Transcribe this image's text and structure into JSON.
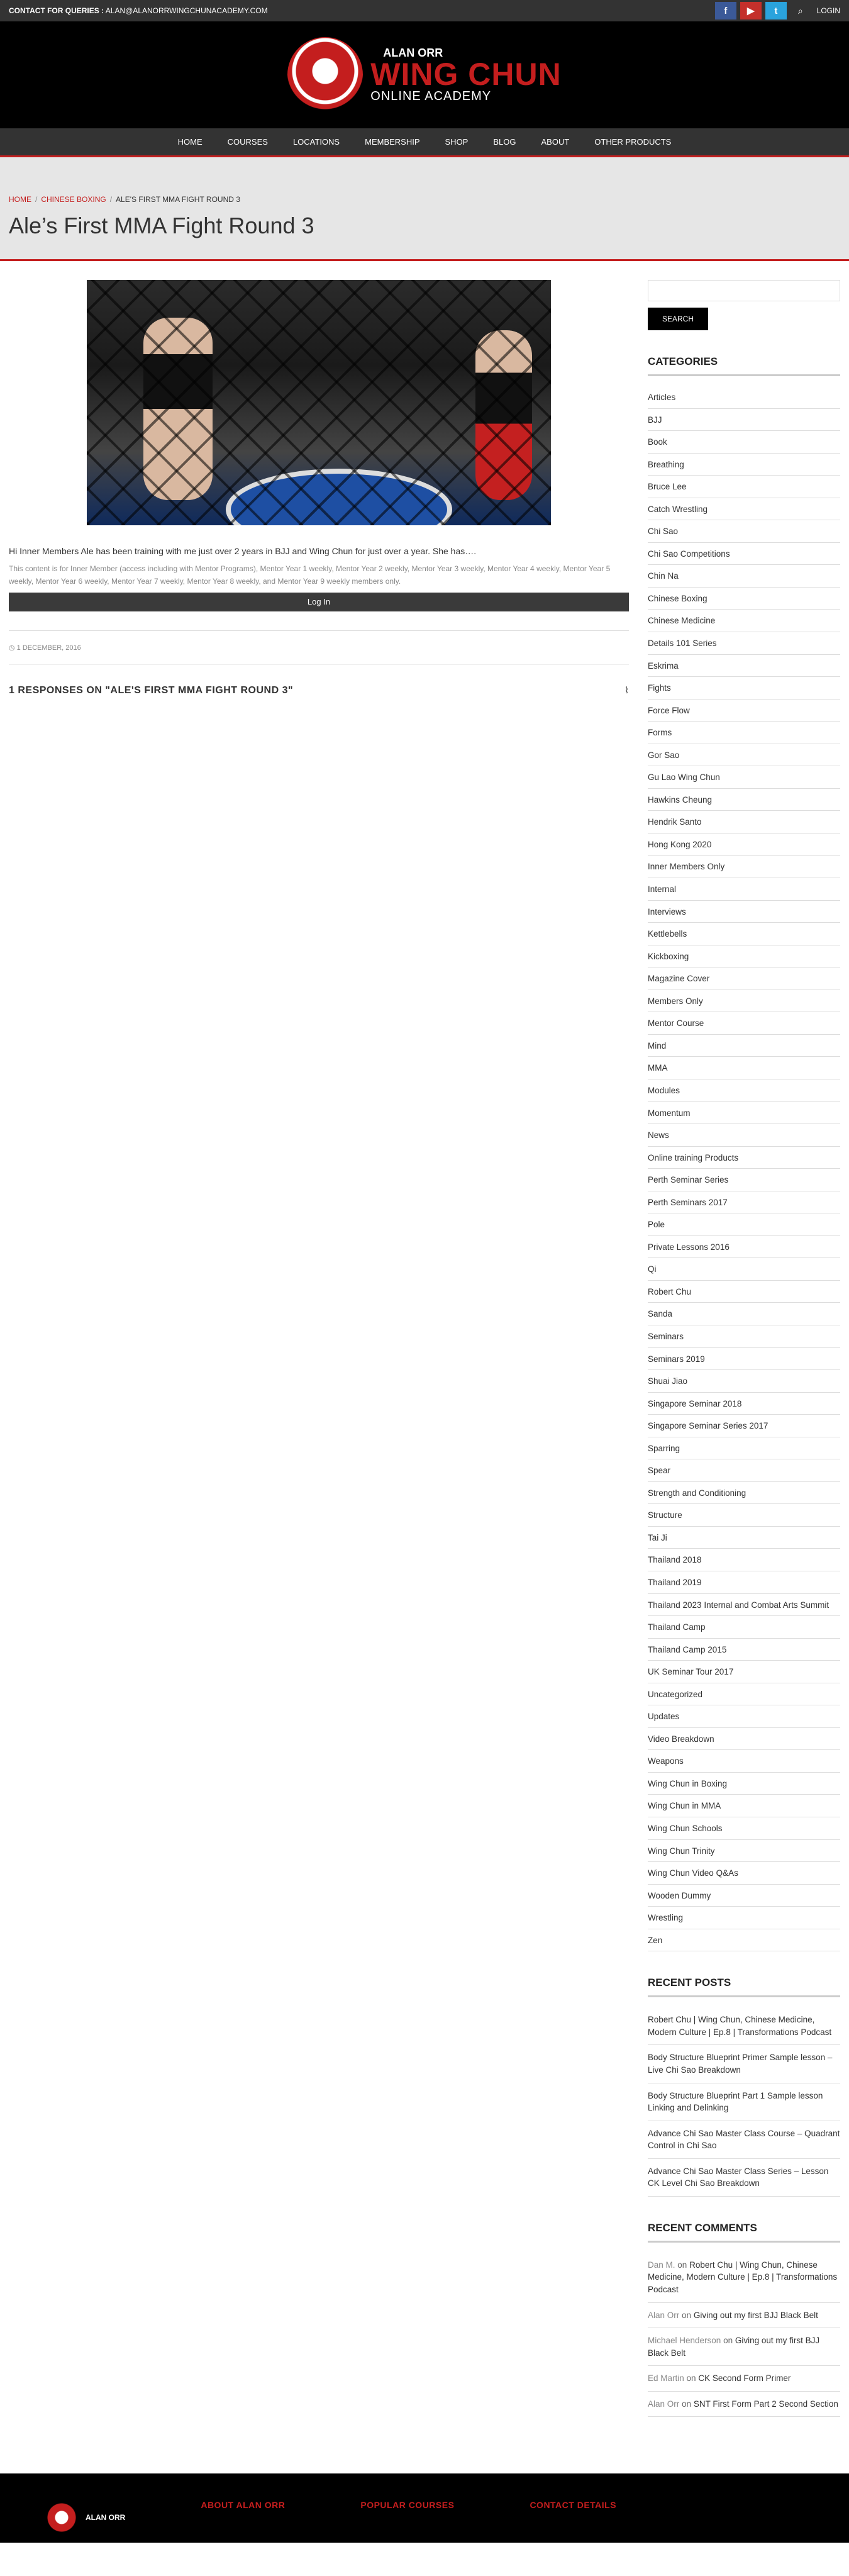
{
  "topbar": {
    "contact_label": "CONTACT FOR QUERIES :",
    "contact_email": "ALAN@ALANORRWINGCHUNACADEMY.COM",
    "login": "LOGIN"
  },
  "logo": {
    "small": "ALAN ORR",
    "big": "WING CHUN",
    "sub": "ONLINE ACADEMY"
  },
  "nav": [
    "HOME",
    "COURSES",
    "LOCATIONS",
    "MEMBERSHIP",
    "SHOP",
    "BLOG",
    "ABOUT",
    "OTHER PRODUCTS"
  ],
  "breadcrumb": {
    "home": "HOME",
    "category": "CHINESE BOXING",
    "current": "ALE'S FIRST MMA FIGHT ROUND 3"
  },
  "post": {
    "title": "Ale’s First MMA Fight Round 3",
    "excerpt": "Hi Inner Members Ale has been training with me just over 2 years in BJJ and Wing Chun for just over a year. She has….",
    "restricted": "This content is for Inner Member (access including with Mentor Programs), Mentor Year 1 weekly, Mentor Year 2 weekly, Mentor Year 3 weekly, Mentor Year 4 weekly, Mentor Year 5 weekly, Mentor Year 6 weekly, Mentor Year 7 weekly, Mentor Year 8 weekly, and Mentor Year 9 weekly members only.",
    "login_button": "Log In",
    "date": "1 DECEMBER, 2016",
    "responses": "1 RESPONSES ON \"ALE'S FIRST MMA FIGHT ROUND 3\""
  },
  "sidebar": {
    "search_button": "SEARCH",
    "categories_title": "CATEGORIES",
    "categories": [
      "Articles",
      "BJJ",
      "Book",
      "Breathing",
      "Bruce Lee",
      "Catch Wrestling",
      "Chi Sao",
      "Chi Sao Competitions",
      "Chin Na",
      "Chinese Boxing",
      "Chinese Medicine",
      "Details 101 Series",
      "Eskrima",
      "Fights",
      "Force Flow",
      "Forms",
      "Gor Sao",
      "Gu Lao Wing Chun",
      "Hawkins Cheung",
      "Hendrik Santo",
      "Hong Kong 2020",
      "Inner Members Only",
      "Internal",
      "Interviews",
      "Kettlebells",
      "Kickboxing",
      "Magazine Cover",
      "Members Only",
      "Mentor Course",
      "Mind",
      "MMA",
      "Modules",
      "Momentum",
      "News",
      "Online training Products",
      "Perth Seminar Series",
      "Perth Seminars 2017",
      "Pole",
      "Private Lessons 2016",
      "Qi",
      "Robert Chu",
      "Sanda",
      "Seminars",
      "Seminars 2019",
      "Shuai Jiao",
      "Singapore Seminar 2018",
      "Singapore Seminar Series 2017",
      "Sparring",
      "Spear",
      "Strength and Conditioning",
      "Structure",
      "Tai Ji",
      "Thailand 2018",
      "Thailand 2019",
      "Thailand 2023 Internal and Combat Arts Summit",
      "Thailand Camp",
      "Thailand Camp 2015",
      "UK Seminar Tour 2017",
      "Uncategorized",
      "Updates",
      "Video Breakdown",
      "Weapons",
      "Wing Chun in Boxing",
      "Wing Chun in MMA",
      "Wing Chun Schools",
      "Wing Chun Trinity",
      "Wing Chun Video Q&As",
      "Wooden Dummy",
      "Wrestling",
      "Zen"
    ],
    "recent_posts_title": "RECENT POSTS",
    "recent_posts": [
      "Robert Chu | Wing Chun, Chinese Medicine, Modern Culture | Ep.8 | Transformations Podcast",
      "Body Structure Blueprint Primer Sample lesson – Live Chi Sao Breakdown",
      "Body Structure Blueprint Part 1 Sample lesson Linking and Delinking",
      "Advance Chi Sao Master Class Course – Quadrant Control in Chi Sao",
      "Advance Chi Sao Master Class Series – Lesson CK Level Chi Sao Breakdown"
    ],
    "recent_comments_title": "RECENT COMMENTS",
    "recent_comments": [
      {
        "author": "Dan M.",
        "on": "on",
        "title": "Robert Chu | Wing Chun, Chinese Medicine, Modern Culture | Ep.8 | Transformations Podcast"
      },
      {
        "author": "Alan Orr",
        "on": "on",
        "title": "Giving out my first BJJ Black Belt"
      },
      {
        "author": "Michael Henderson",
        "on": "on",
        "title": "Giving out my first BJJ Black Belt"
      },
      {
        "author": "Ed Martin",
        "on": "on",
        "title": "CK Second Form Primer"
      },
      {
        "author": "Alan Orr",
        "on": "on",
        "title": "SNT First Form Part 2 Second Section"
      }
    ]
  },
  "footer": {
    "logo_text": "ALAN ORR",
    "about": "ABOUT ALAN ORR",
    "popular": "POPULAR COURSES",
    "contact": "CONTACT DETAILS"
  }
}
